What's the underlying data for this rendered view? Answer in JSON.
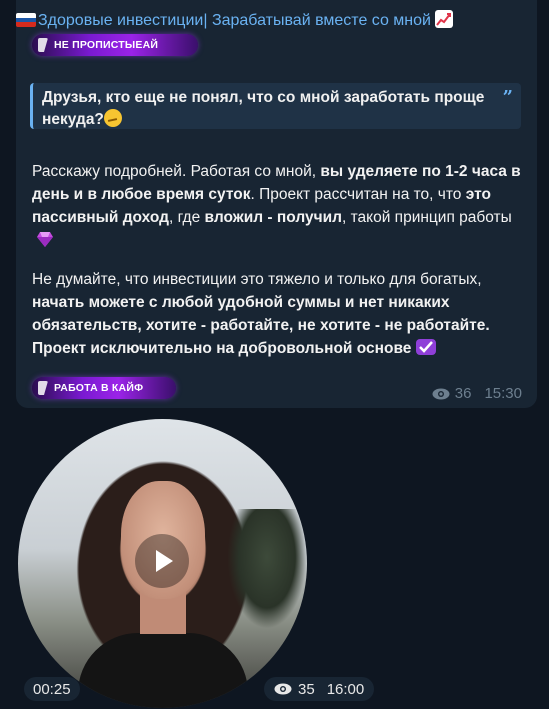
{
  "post": {
    "channel_title": "Здоровые инвестиции| Зарабатывай вместе со мной",
    "flag_icon": "russia-flag-icon",
    "chart_icon": "chart-increasing-icon",
    "badge_top": "НЕ ПРОПИСТЫЕАЙ",
    "quote": {
      "text": "Друзья, кто еще не понял, что со мной заработать проще некуда?",
      "emoji": "thinking-face-icon"
    },
    "paragraph1": {
      "t1": "Расскажу подробней. Работая со мной, ",
      "b1": "вы уделяете по 1-2 часа в день и в любое время суток",
      "t2": ". Проект рассчитан на то, что ",
      "b2": "это пассивный доход",
      "t3": ", где ",
      "b3": "вложил - получил",
      "t4": ", такой принцип работы",
      "emoji": "gem-icon"
    },
    "paragraph2": {
      "t1": "Не думайте, что инвестиции это тяжело и только для богатых, ",
      "b1": "начать можете с любой удобной суммы и нет никаких обязательств, хотите - работайте, не хотите - не работайте. Проект исключительно на добровольной основе",
      "emoji": "check-mark-icon"
    },
    "badge_bottom": "РАБОТА В КАЙФ",
    "views": "36",
    "time": "15:30"
  },
  "video_message": {
    "duration": "00:25",
    "views": "35",
    "time": "16:00"
  },
  "colors": {
    "background": "#0e1621",
    "bubble": "#182533",
    "accent": "#6ab2f2",
    "meta": "#6d7f8f"
  }
}
